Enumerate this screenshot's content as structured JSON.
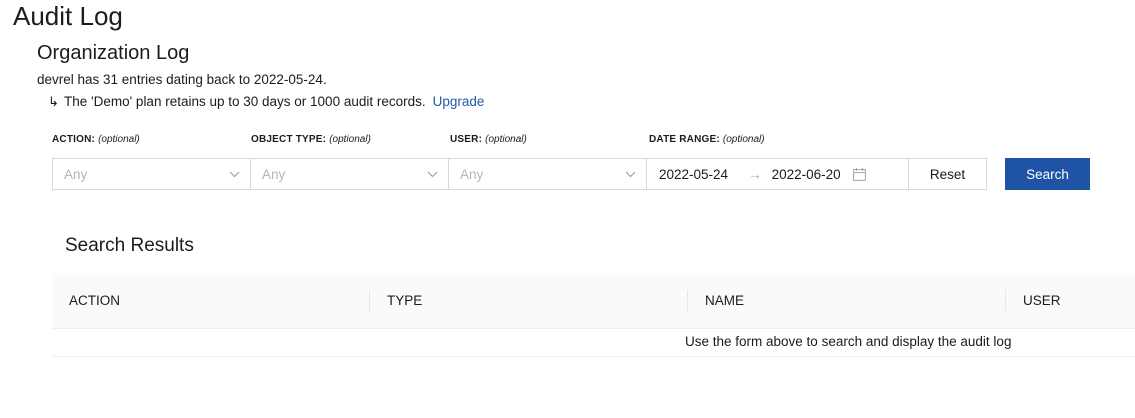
{
  "page": {
    "title": "Audit Log"
  },
  "org": {
    "section_title": "Organization Log",
    "summary": "devrel has 31 entries dating back to 2022-05-24.",
    "plan_note": "The 'Demo' plan retains up to 30 days or 1000 audit records.",
    "upgrade_link": "Upgrade"
  },
  "filters": {
    "action": {
      "label": "ACTION:",
      "hint": "(optional)",
      "value": "Any"
    },
    "object_type": {
      "label": "OBJECT TYPE:",
      "hint": "(optional)",
      "value": "Any"
    },
    "user": {
      "label": "USER:",
      "hint": "(optional)",
      "value": "Any"
    },
    "date_range": {
      "label": "DATE RANGE:",
      "hint": "(optional)",
      "start": "2022-05-24",
      "end": "2022-06-20"
    },
    "reset_label": "Reset",
    "search_label": "Search"
  },
  "results": {
    "title": "Search Results",
    "columns": [
      "ACTION",
      "TYPE",
      "NAME",
      "USER"
    ],
    "empty_message": "Use the form above to search and display the audit log"
  },
  "icons": {
    "arrow": "return-arrow-icon",
    "dropdown": "chevron-down-icon",
    "range_separator": "arrow-right-icon",
    "calendar": "calendar-icon"
  },
  "colors": {
    "primary": "#1f53a6",
    "link": "#1f5aa6",
    "placeholder": "#b5b5b5",
    "border": "#d9d9d9",
    "table_header_bg": "#fafafa"
  }
}
